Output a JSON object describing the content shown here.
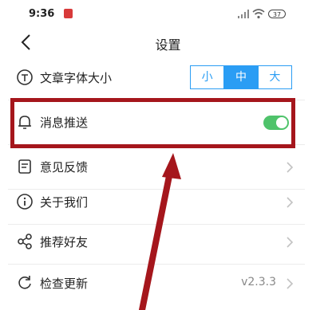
{
  "status": {
    "time": "9:36",
    "battery": "37"
  },
  "header": {
    "title": "设置"
  },
  "settings": [
    {
      "label": "文章字体大小",
      "icon": "font-size-icon",
      "sizes": [
        "小",
        "中",
        "大"
      ],
      "selected": "中"
    },
    {
      "label": "消息推送",
      "icon": "bell-icon",
      "toggle_on": true
    },
    {
      "label": "意见反馈",
      "icon": "feedback-icon"
    },
    {
      "label": "关于我们",
      "icon": "info-icon"
    },
    {
      "label": "推荐好友",
      "icon": "share-icon"
    },
    {
      "label": "检查更新",
      "icon": "refresh-icon",
      "version": "v2.3.3"
    }
  ],
  "colors": {
    "accent": "#2a9df4",
    "toggle": "#4fc36b",
    "annotation": "#a5161c"
  }
}
